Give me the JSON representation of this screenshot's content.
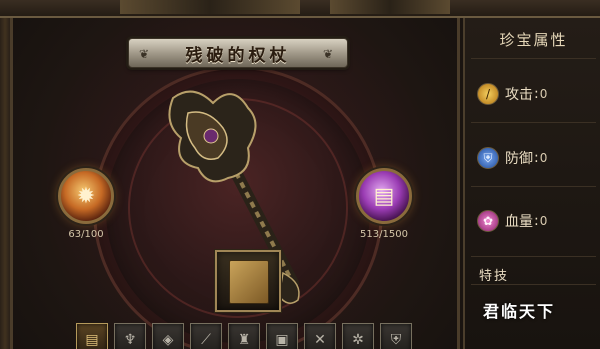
{
  "item": {
    "title": "残破的权杖"
  },
  "left_orb": {
    "icon": "fire-gem-icon",
    "progress_label": "63/100",
    "progress": {
      "current": 63,
      "max": 100
    }
  },
  "right_orb": {
    "icon": "spellbook-icon",
    "progress_label": "513/1500",
    "progress": {
      "current": 513,
      "max": 1500
    }
  },
  "center_slot": {
    "icon": "tome-icon"
  },
  "slots": [
    {
      "icon": "tome-icon",
      "active": true
    },
    {
      "icon": "winged-helm-icon"
    },
    {
      "icon": "armor-icon"
    },
    {
      "icon": "blade-icon"
    },
    {
      "icon": "helmet-icon"
    },
    {
      "icon": "chestplate-icon"
    },
    {
      "icon": "crossed-blades-icon"
    },
    {
      "icon": "spider-icon"
    },
    {
      "icon": "shield-emblem-icon"
    }
  ],
  "side": {
    "header": "珍宝属性",
    "stats": [
      {
        "name": "攻击",
        "value": "0",
        "icon": "attack-icon",
        "color": "#e0a020"
      },
      {
        "name": "防御",
        "value": "0",
        "icon": "defense-icon",
        "color": "#3a6ed0"
      },
      {
        "name": "血量",
        "value": "0",
        "icon": "health-icon",
        "color": "#c03a9a"
      }
    ],
    "skill_tab": "特技",
    "skill_name": "君临天下"
  }
}
